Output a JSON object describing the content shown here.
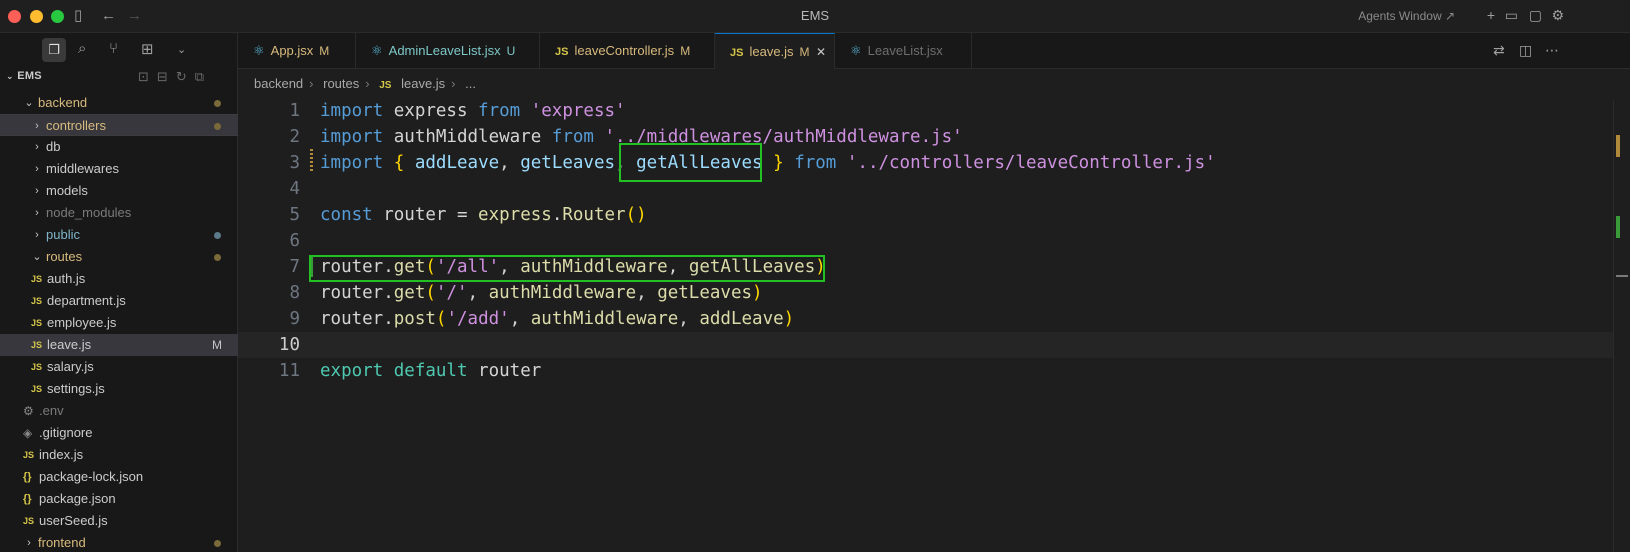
{
  "window": {
    "title": "EMS",
    "agents_label": "Agents Window ↗"
  },
  "explorer": {
    "header": "EMS",
    "tree": [
      {
        "label": "backend",
        "type": "folder",
        "open": true,
        "depth": 0,
        "dot": "mod"
      },
      {
        "label": "controllers",
        "type": "folder",
        "open": false,
        "depth": 1,
        "dot": "mod",
        "selected": true
      },
      {
        "label": "db",
        "type": "folder",
        "open": false,
        "depth": 1
      },
      {
        "label": "middlewares",
        "type": "folder",
        "open": false,
        "depth": 1
      },
      {
        "label": "models",
        "type": "folder",
        "open": false,
        "depth": 1
      },
      {
        "label": "node_modules",
        "type": "folder",
        "open": false,
        "depth": 1,
        "dim": true
      },
      {
        "label": "public",
        "type": "folder",
        "open": false,
        "depth": 1,
        "dot": "new"
      },
      {
        "label": "routes",
        "type": "folder",
        "open": true,
        "depth": 1,
        "dot": "mod"
      },
      {
        "label": "auth.js",
        "type": "js",
        "depth": 2
      },
      {
        "label": "department.js",
        "type": "js",
        "depth": 2
      },
      {
        "label": "employee.js",
        "type": "js",
        "depth": 2
      },
      {
        "label": "leave.js",
        "type": "js",
        "depth": 2,
        "active": true,
        "badge": "M"
      },
      {
        "label": "salary.js",
        "type": "js",
        "depth": 2
      },
      {
        "label": "settings.js",
        "type": "js",
        "depth": 2
      },
      {
        "label": ".env",
        "type": "env",
        "depth": 1,
        "dim": true
      },
      {
        "label": ".gitignore",
        "type": "git",
        "depth": 1
      },
      {
        "label": "index.js",
        "type": "js",
        "depth": 1
      },
      {
        "label": "package-lock.json",
        "type": "json",
        "depth": 1
      },
      {
        "label": "package.json",
        "type": "json",
        "depth": 1
      },
      {
        "label": "userSeed.js",
        "type": "js",
        "depth": 1
      },
      {
        "label": "frontend",
        "type": "folder",
        "open": false,
        "depth": 0,
        "dot": "mod"
      }
    ]
  },
  "tabs": [
    {
      "label": "App.jsx",
      "badge": "M",
      "icon": "react-icon"
    },
    {
      "label": "AdminLeaveList.jsx",
      "badge": "U",
      "icon": "react-icon"
    },
    {
      "label": "leaveController.js",
      "badge": "M",
      "icon": "js-icon"
    },
    {
      "label": "leave.js",
      "badge": "M",
      "icon": "js-icon",
      "active": true
    },
    {
      "label": "LeaveList.jsx",
      "badge": "",
      "icon": "react-icon",
      "dim": true
    }
  ],
  "breadcrumb": [
    "backend",
    "routes",
    "leave.js",
    "..."
  ],
  "code": {
    "current_line": 10,
    "lines": [
      [
        [
          "kw",
          "import"
        ],
        [
          "id",
          " express "
        ],
        [
          "kw",
          "from"
        ],
        [
          "str",
          " 'express'"
        ]
      ],
      [
        [
          "kw",
          "import"
        ],
        [
          "id",
          " authMiddleware "
        ],
        [
          "kw",
          "from"
        ],
        [
          "str",
          " '../middlewares/authMiddleware.js'"
        ]
      ],
      [
        [
          "kw",
          "import"
        ],
        [
          "id",
          " "
        ],
        [
          "br",
          "{"
        ],
        [
          "var",
          " addLeave"
        ],
        [
          "id",
          ", "
        ],
        [
          "var",
          "getLeaves"
        ],
        [
          "id",
          ", "
        ],
        [
          "var",
          "getAllLeaves"
        ],
        [
          "id",
          " "
        ],
        [
          "br",
          "}"
        ],
        [
          "kw",
          " from"
        ],
        [
          "str",
          " '../controllers/leaveController.js'"
        ]
      ],
      [],
      [
        [
          "kw",
          "const"
        ],
        [
          "id",
          " router = "
        ],
        [
          "fn",
          "express"
        ],
        [
          "id",
          "."
        ],
        [
          "fn",
          "Router"
        ],
        [
          "br",
          "()"
        ]
      ],
      [],
      [
        [
          "id",
          "router."
        ],
        [
          "fn",
          "get"
        ],
        [
          "br",
          "("
        ],
        [
          "str",
          "'/all'"
        ],
        [
          "id",
          ", "
        ],
        [
          "fn",
          "authMiddleware"
        ],
        [
          "id",
          ", "
        ],
        [
          "fn",
          "getAllLeaves"
        ],
        [
          "br",
          ")"
        ]
      ],
      [
        [
          "id",
          "router."
        ],
        [
          "fn",
          "get"
        ],
        [
          "br",
          "("
        ],
        [
          "str",
          "'/'"
        ],
        [
          "id",
          ", "
        ],
        [
          "fn",
          "authMiddleware"
        ],
        [
          "id",
          ", "
        ],
        [
          "fn",
          "getLeaves"
        ],
        [
          "br",
          ")"
        ]
      ],
      [
        [
          "id",
          "router."
        ],
        [
          "fn",
          "post"
        ],
        [
          "br",
          "("
        ],
        [
          "str",
          "'/add'"
        ],
        [
          "id",
          ", "
        ],
        [
          "fn",
          "authMiddleware"
        ],
        [
          "id",
          ", "
        ],
        [
          "fn",
          "addLeave"
        ],
        [
          "br",
          ")"
        ]
      ],
      [],
      [
        [
          "kw2",
          "export"
        ],
        [
          "kw2",
          " default"
        ],
        [
          "id",
          " router"
        ]
      ]
    ]
  },
  "colors": {
    "highlight_box": "#22c022",
    "accent": "#0078d4"
  }
}
